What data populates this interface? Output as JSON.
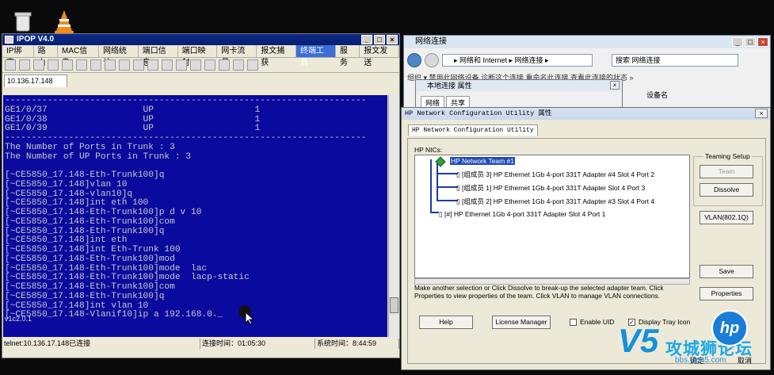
{
  "ipop": {
    "title": "IPOP V4.0",
    "window_buttons": [
      "_",
      "□",
      "×"
    ],
    "menu": [
      "IP绑定",
      "路由",
      "MAC信息",
      "网络统计",
      "端口信息",
      "端口映射",
      "网卡流量",
      "报文捕获",
      "终端工具",
      "服务",
      "报文发送"
    ],
    "active_menu": "终端工具",
    "session_tab": "10.136.17.148",
    "terminal_lines": [
      "--------------------------------------------------------------------",
      "GE1/0/37                  UP                   1",
      "GE1/0/38                  UP                   1",
      "GE1/0/39                  UP                   1",
      "--------------------------------------------------------------------",
      "The Number of Ports in Trunk : 3",
      "The Number of UP Ports in Trunk : 3",
      "",
      "[~CE5850_17.148-Eth-Trunk100]q",
      "[~CE5850_17.148]vlan 10",
      "[~CE5850_17.148-vlan10]q",
      "[~CE5850_17.148]int eth 100",
      "[~CE5850_17.148-Eth-Trunk100]p d v 10",
      "[~CE5850_17.148-Eth-Trunk100]com",
      "[~CE5850_17.148-Eth-Trunk100]q",
      "[~CE5850_17.148]int eth",
      "[~CE5850_17.148]int Eth-Trunk 100",
      "[~CE5850_17.148-Eth-Trunk100]mod",
      "[~CE5850_17.148-Eth-Trunk100]mode  lac",
      "[~CE5850_17.148-Eth-Trunk100]mode  lacp-static",
      "[~CE5850_17.148-Eth-Trunk100]com",
      "[~CE5850_17.148-Eth-Trunk100]q",
      "[~CE5850_17.148]int vlan 10",
      "[~CE5850_17.148-Vlanif10]ip a 192.168.0._"
    ],
    "status": {
      "connection": "telnet:10.136.17.148已连接",
      "connect_time": "连接时间：01:05:30",
      "system_time": "系统时间：8:44:59"
    },
    "version": "v1c2.0.1"
  },
  "network": {
    "title": "网络连接",
    "address": "▸ 网络和 Internet ▸ 网络连接 ▸",
    "search_placeholder": "搜索 网络连接",
    "commands": "组织 ▾    禁用此网络设备    诊断这个连接    重命名此连接    查看此连接的状态    »",
    "device_column": "设备名"
  },
  "local_props": {
    "title": "本地连接 属性",
    "tabs": [
      "网络",
      "共享"
    ]
  },
  "hp_dialog": {
    "title": "HP Network Configuration Utility 属性",
    "tab": "HP Network Configuration Utility",
    "nics_label": "HP NICs:",
    "team": "HP Network Team #1",
    "members": [
      "[组成员 3] HP Ethernet 1Gb 4-port 331T Adapter #4 Slot 4 Port 2",
      "[组成员 1] HP Ethernet 1Gb 4-port 331T Adapter Slot 4 Port 3",
      "[组成员 2] HP Ethernet 1Gb 4-port 331T Adapter #3 Slot 4 Port 4"
    ],
    "standalone": "[#] HP Ethernet 1Gb 4-port 331T Adapter Slot 4 Port 1",
    "teaming_setup": "Teaming Setup",
    "team_button": "Team",
    "dissolve_button": "Dissolve",
    "vlan_button": "VLAN(802.1Q)",
    "save_button": "Save",
    "properties_button": "Properties",
    "description": "Make another selection or Click Dissolve to break-up the selected adapter team.  Click Properties to view properties of the team.  Click VLAN to manage VLAN connections.",
    "help_button": "Help",
    "license_button": "License Manager",
    "enable_uid": "Enable UID",
    "display_tray": "Display Tray Icon",
    "ok_button": "确定",
    "cancel_button": "取消"
  },
  "watermark": {
    "text": "攻城狮论坛",
    "url": "bbs.vlan5.com",
    "v5": "V5",
    "hp": "hp"
  },
  "colors": {
    "terminal_bg": "#0a0a9e",
    "title_bar": "#0b2a8a",
    "accent": "#1ea8e6"
  }
}
